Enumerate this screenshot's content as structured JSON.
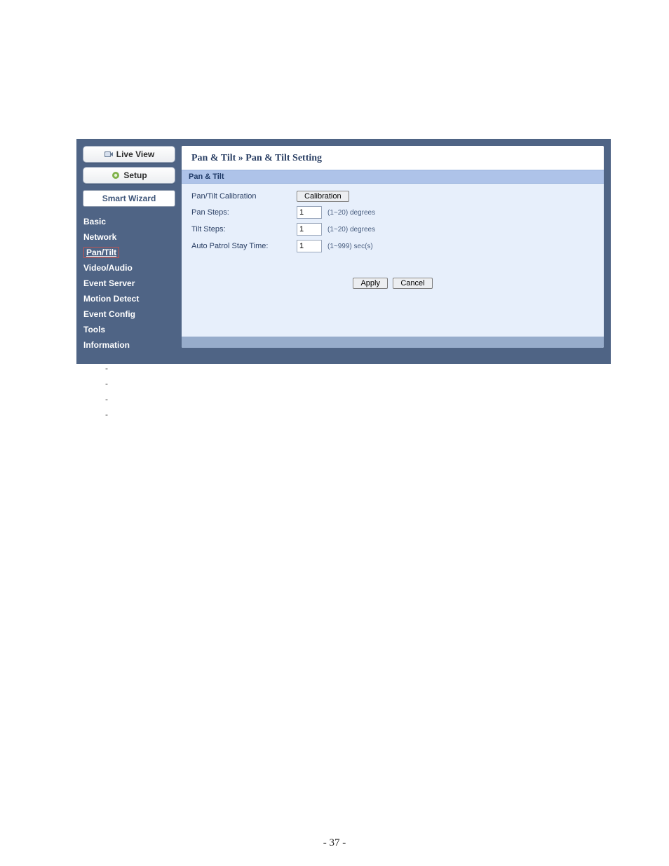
{
  "sidebar": {
    "live_view_label": "Live View",
    "setup_label": "Setup",
    "smart_wizard_label": "Smart Wizard",
    "nav": [
      {
        "label": "Basic",
        "selected": false
      },
      {
        "label": "Network",
        "selected": false
      },
      {
        "label": "Pan/Tilt",
        "selected": true
      },
      {
        "label": "Video/Audio",
        "selected": false
      },
      {
        "label": "Event Server",
        "selected": false
      },
      {
        "label": "Motion Detect",
        "selected": false
      },
      {
        "label": "Event Config",
        "selected": false
      },
      {
        "label": "Tools",
        "selected": false
      },
      {
        "label": "Information",
        "selected": false
      }
    ]
  },
  "breadcrumb": {
    "segment1": "Pan & Tilt",
    "sep": " » ",
    "segment2": "Pan & Tilt Setting"
  },
  "section_header": "Pan & Tilt",
  "form": {
    "calibration_label": "Pan/Tilt Calibration",
    "calibration_button": "Calibration",
    "pan_steps_label": "Pan Steps:",
    "pan_steps_value": "1",
    "pan_steps_suffix": "(1~20) degrees",
    "tilt_steps_label": "Tilt Steps:",
    "tilt_steps_value": "1",
    "tilt_steps_suffix": "(1~20) degrees",
    "auto_patrol_label": "Auto Patrol Stay Time:",
    "auto_patrol_value": "1",
    "auto_patrol_suffix": "(1~999) sec(s)"
  },
  "buttons": {
    "apply": "Apply",
    "cancel": "Cancel"
  },
  "dash": "-",
  "page_number": "- 37 -"
}
